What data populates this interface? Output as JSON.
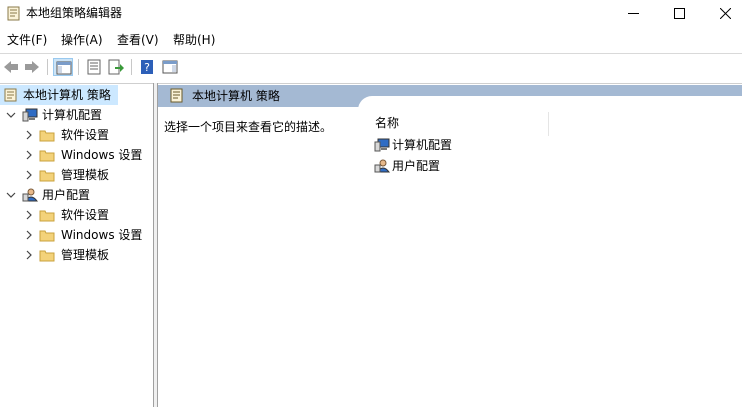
{
  "window": {
    "title": "本地组策略编辑器"
  },
  "menu": [
    {
      "label": "文件(F)"
    },
    {
      "label": "操作(A)"
    },
    {
      "label": "查看(V)"
    },
    {
      "label": "帮助(H)"
    }
  ],
  "toolbar": {
    "buttons": [
      {
        "icon": "back-arrow-icon"
      },
      {
        "icon": "forward-arrow-icon"
      },
      {
        "icon": "show-hide-tree-icon"
      },
      {
        "icon": "properties-icon"
      },
      {
        "icon": "export-list-icon"
      },
      {
        "icon": "help-icon"
      },
      {
        "icon": "show-hide-action-pane-icon"
      }
    ]
  },
  "tree": {
    "root": "本地计算机 策略",
    "computer": {
      "label": "计算机配置",
      "children": [
        "软件设置",
        "Windows 设置",
        "管理模板"
      ]
    },
    "user": {
      "label": "用户配置",
      "children": [
        "软件设置",
        "Windows 设置",
        "管理模板"
      ]
    }
  },
  "content": {
    "header_title": "本地计算机 策略",
    "description": "选择一个项目来查看它的描述。",
    "column_name": "名称",
    "items": [
      "计算机配置",
      "用户配置"
    ]
  },
  "colors": {
    "header_band": "#a4b9d3",
    "selection": "#cce8ff",
    "folder": "#f3d27a"
  }
}
